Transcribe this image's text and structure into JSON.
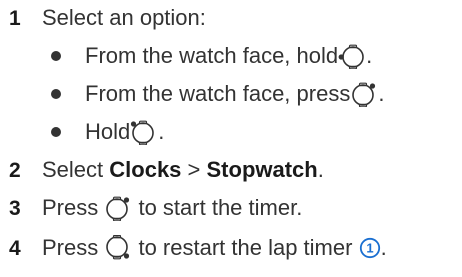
{
  "steps": [
    {
      "number": "1",
      "text": "Select an option:"
    },
    {
      "number": "2",
      "prefix": "Select ",
      "bold1": "Clocks",
      "sep": " > ",
      "bold2": "Stopwatch",
      "suffix": "."
    },
    {
      "number": "3",
      "prefix": "Press ",
      "suffix": " to start the timer."
    },
    {
      "number": "4",
      "prefix": "Press ",
      "middle": " to restart the lap timer ",
      "callout": "1",
      "suffix": "."
    }
  ],
  "options": [
    {
      "text": "From the watch face, hold ",
      "suffix": "."
    },
    {
      "text": "From the watch face, press ",
      "suffix": "."
    },
    {
      "text": "Hold ",
      "suffix": "."
    }
  ],
  "icons": {
    "left_button": "watch-left-button-icon",
    "top_right_button": "watch-top-right-button-icon",
    "bottom_right_button": "watch-bottom-right-button-icon"
  },
  "colors": {
    "text": "#333333",
    "icon_stroke": "#333333",
    "callout": "#1a6fd1"
  }
}
